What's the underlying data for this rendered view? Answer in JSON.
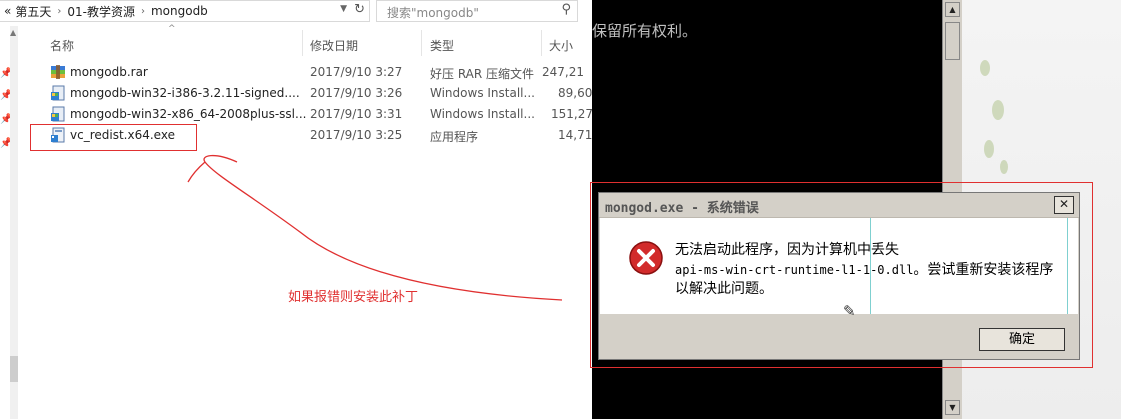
{
  "explorer": {
    "breadcrumb": {
      "overflow": "«",
      "segments": [
        "第五天",
        "01-教学资源",
        "mongodb"
      ]
    },
    "search": {
      "placeholder": "搜索\"mongodb\""
    },
    "columns": {
      "name": "名称",
      "date": "修改日期",
      "type": "类型",
      "size": "大小"
    },
    "files": [
      {
        "name": "mongodb.rar",
        "date": "2017/9/10 3:27",
        "type": "好压 RAR 压缩文件",
        "size": "247,21",
        "icon": "rar-archive-icon"
      },
      {
        "name": "mongodb-win32-i386-3.2.11-signed....",
        "date": "2017/9/10 3:26",
        "type": "Windows Install...",
        "size": "89,60",
        "icon": "msi-installer-icon"
      },
      {
        "name": "mongodb-win32-x86_64-2008plus-ssl...",
        "date": "2017/9/10 3:31",
        "type": "Windows Install...",
        "size": "151,27",
        "icon": "msi-installer-icon"
      },
      {
        "name": "vc_redist.x64.exe",
        "date": "2017/9/10 3:25",
        "type": "应用程序",
        "size": "14,71",
        "icon": "exe-installer-icon"
      }
    ]
  },
  "annotation": {
    "text": "如果报错则安装此补丁",
    "color": "#e03030"
  },
  "console": {
    "text": "保留所有权利。"
  },
  "dialog": {
    "title": "mongod.exe - 系统错误",
    "line1": "无法启动此程序，因为计算机中丢失",
    "line2_code": "api-ms-win-crt-runtime-l1-1-0.dll",
    "line2_rest": "。尝试重新安装该程序",
    "line3": "以解决此问题。",
    "ok_label": "确定",
    "icon": "error-icon"
  }
}
